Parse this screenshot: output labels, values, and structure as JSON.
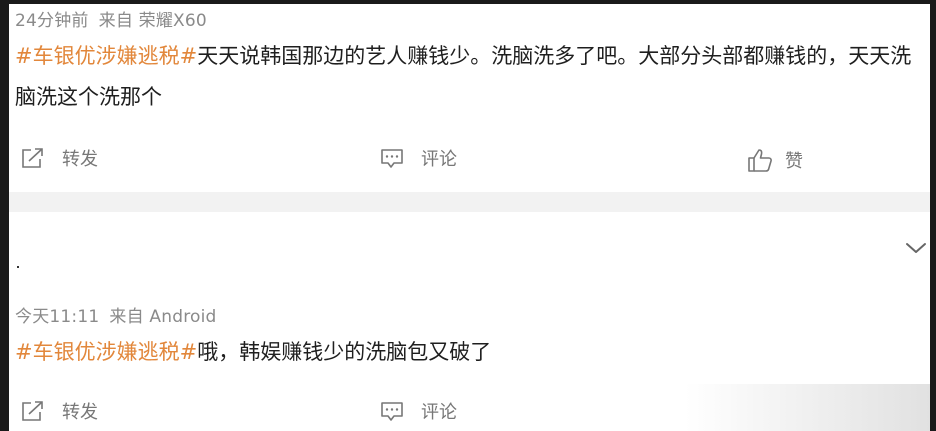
{
  "posts": [
    {
      "meta_time": "24分钟前",
      "meta_source": "来自 荣耀X60",
      "hashtag": "#车银优涉嫌逃税#",
      "text": "天天说韩国那边的艺人赚钱少。洗脑洗多了吧。大部分头部都赚钱的，天天洗脑洗这个洗那个",
      "actions": {
        "repost": "转发",
        "comment": "评论",
        "like": "赞"
      }
    },
    {
      "meta_time": "今天11:11",
      "meta_source": "来自 Android",
      "hashtag": "#车银优涉嫌逃税#",
      "text": "哦，韩娱赚钱少的洗脑包又破了",
      "actions": {
        "repost": "转发",
        "comment": "评论"
      }
    }
  ],
  "colors": {
    "hashtag": "#e2873b",
    "text": "#1f1f1f",
    "meta": "#8a8a8a",
    "action": "#777777",
    "divider": "#f2f2f2"
  },
  "icons": {
    "repost": "share-icon",
    "comment": "comment-icon",
    "like": "thumbs-up-icon",
    "expand": "chevron-down-icon"
  }
}
